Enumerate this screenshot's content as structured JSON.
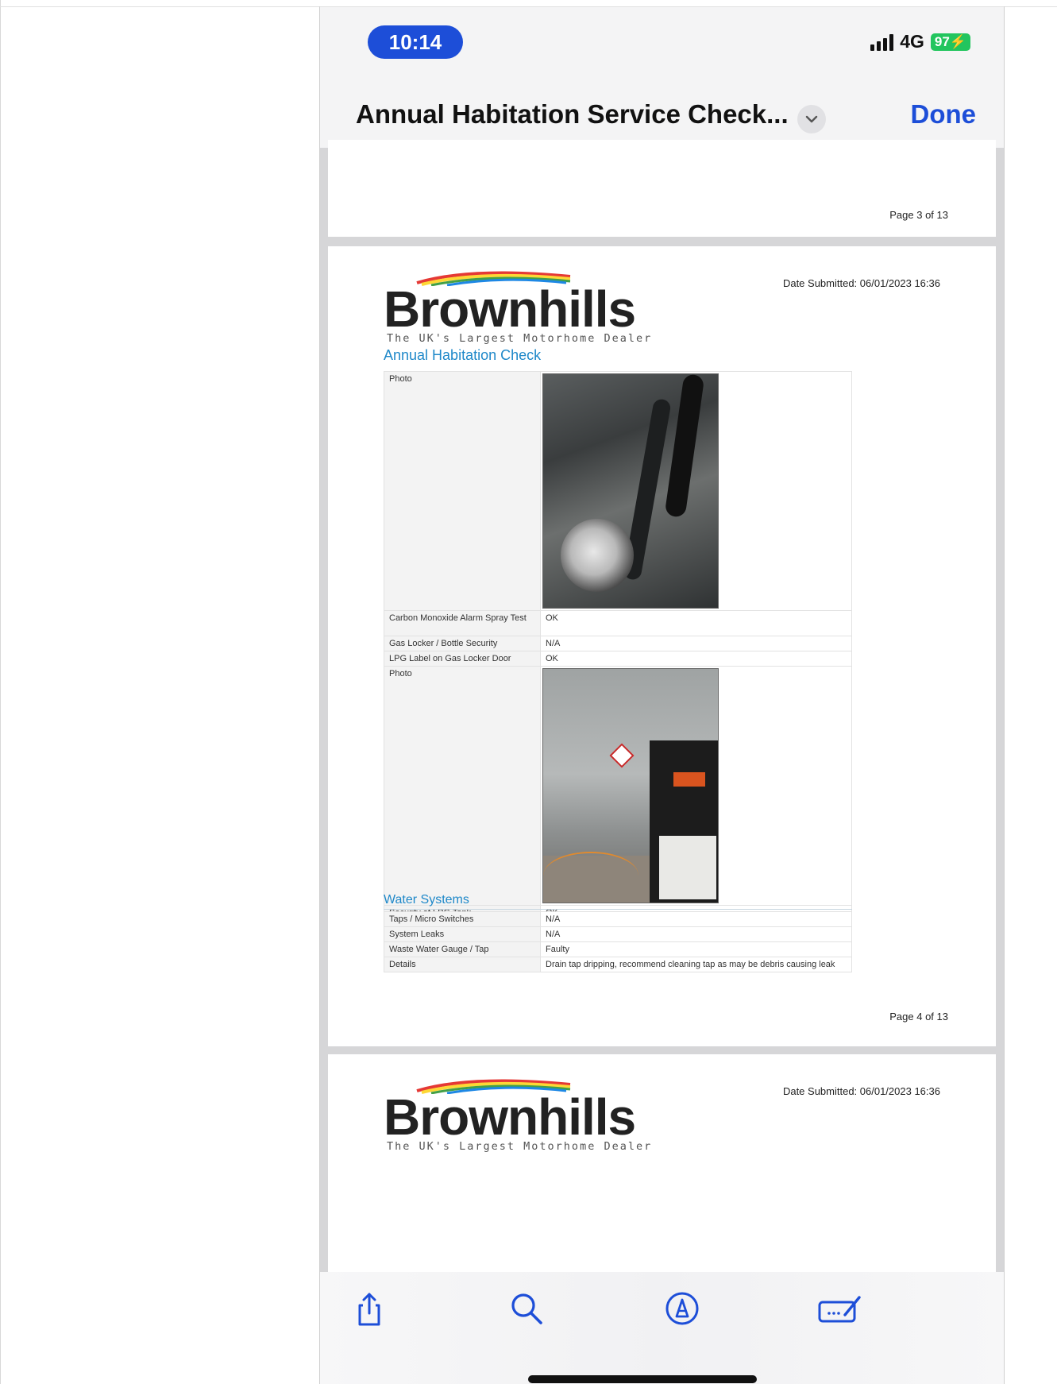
{
  "status_bar": {
    "time": "10:14",
    "network": "4G",
    "battery": "97"
  },
  "nav": {
    "title": "Annual Habitation Service Check...",
    "done_label": "Done"
  },
  "document": {
    "page3": {
      "page_label": "Page 3 of 13"
    },
    "page4": {
      "logo_word": "Brownhills",
      "logo_tagline": "The UK's Largest Motorhome Dealer",
      "date_submitted": "Date Submitted: 06/01/2023 16:36",
      "section_title": "Annual Habitation Check",
      "rows_a": [
        {
          "label": "Photo",
          "value": ""
        },
        {
          "label": "Carbon Monoxide Alarm Spray Test",
          "value": "OK"
        },
        {
          "label": "Gas Locker / Bottle Security",
          "value": "N/A"
        },
        {
          "label": "LPG Label on Gas Locker Door",
          "value": "OK"
        },
        {
          "label": "Photo",
          "value": ""
        },
        {
          "label": "Security of LPG Tank",
          "value": "OK"
        }
      ],
      "water_title": "Water Systems",
      "water_rows": [
        {
          "label": "Taps / Micro Switches",
          "value": "N/A"
        },
        {
          "label": "System Leaks",
          "value": "N/A"
        },
        {
          "label": "Waste Water Gauge / Tap",
          "value": "Faulty"
        },
        {
          "label": "Details",
          "value": "Drain tap dripping, recommend cleaning tap as may be debris causing leak"
        }
      ],
      "page_label": "Page 4 of 13"
    },
    "page5": {
      "logo_word": "Brownhills",
      "logo_tagline": "The UK's Largest Motorhome Dealer",
      "date_submitted": "Date Submitted: 06/01/2023 16:36"
    }
  },
  "toolbar": {
    "icons": [
      "share-icon",
      "search-icon",
      "markup-icon",
      "signature-icon"
    ]
  },
  "colors": {
    "accent": "#1d4ed8",
    "section_blue": "#1e88c9",
    "battery_green": "#22c55e"
  }
}
